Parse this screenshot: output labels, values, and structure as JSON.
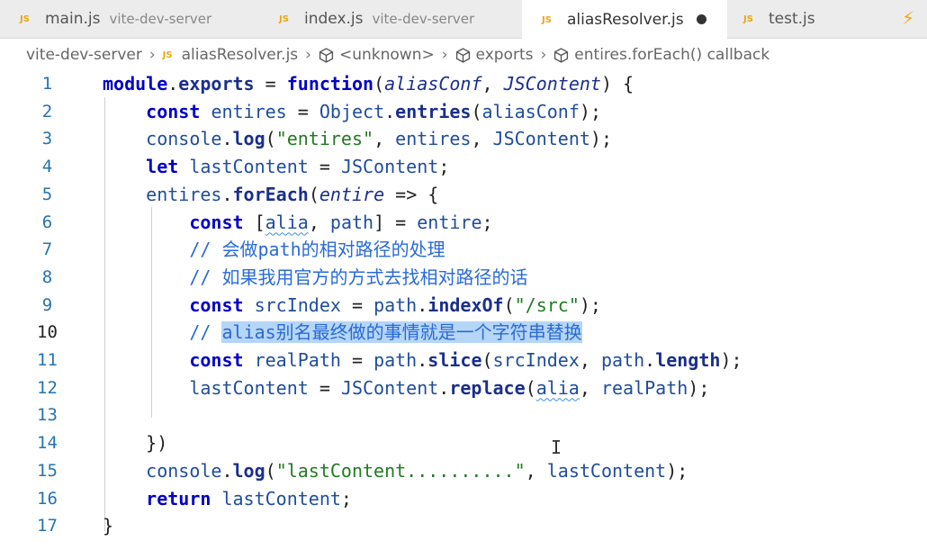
{
  "tabs": [
    {
      "name": "main.js",
      "desc": "vite-dev-server",
      "active": false,
      "modified": false
    },
    {
      "name": "index.js",
      "desc": "vite-dev-server",
      "active": false,
      "modified": false
    },
    {
      "name": "aliasResolver.js",
      "desc": "",
      "active": true,
      "modified": true
    },
    {
      "name": "test.js",
      "desc": "",
      "active": false,
      "modified": false
    }
  ],
  "file_icon_text": "JS",
  "breadcrumb": {
    "folder": "vite-dev-server",
    "file": "aliasResolver.js",
    "symbol1": "<unknown>",
    "symbol2": "exports",
    "symbol3": "entires.forEach() callback"
  },
  "current_line": 10,
  "code_lines": [
    "module.exports = function(aliasConf, JSContent) {",
    "    const entires = Object.entries(aliasConf);",
    "    console.log(\"entires\", entires, JSContent);",
    "    let lastContent = JSContent;",
    "    entires.forEach(entire => {",
    "        const [alia, path] = entire;",
    "        // 会做path的相对路径的处理",
    "        // 如果我用官方的方式去找相对路径的话",
    "        const srcIndex = path.indexOf(\"/src\");",
    "        // alias别名最终做的事情就是一个字符串替换",
    "        const realPath = path.slice(srcIndex, path.length);",
    "        lastContent = JSContent.replace(alia, realPath);",
    "",
    "    })",
    "    console.log(\"lastContent..........\", lastContent);",
    "    return lastContent;",
    "}"
  ],
  "line_numbers": [
    "1",
    "2",
    "3",
    "4",
    "5",
    "6",
    "7",
    "8",
    "9",
    "10",
    "11",
    "12",
    "13",
    "14",
    "15",
    "16",
    "17"
  ],
  "colors": {
    "keyword": "#0000c8",
    "string": "#227a22",
    "comment": "#2a6ad6",
    "selection": "#b6d6f7",
    "js_icon": "#e6a817"
  }
}
